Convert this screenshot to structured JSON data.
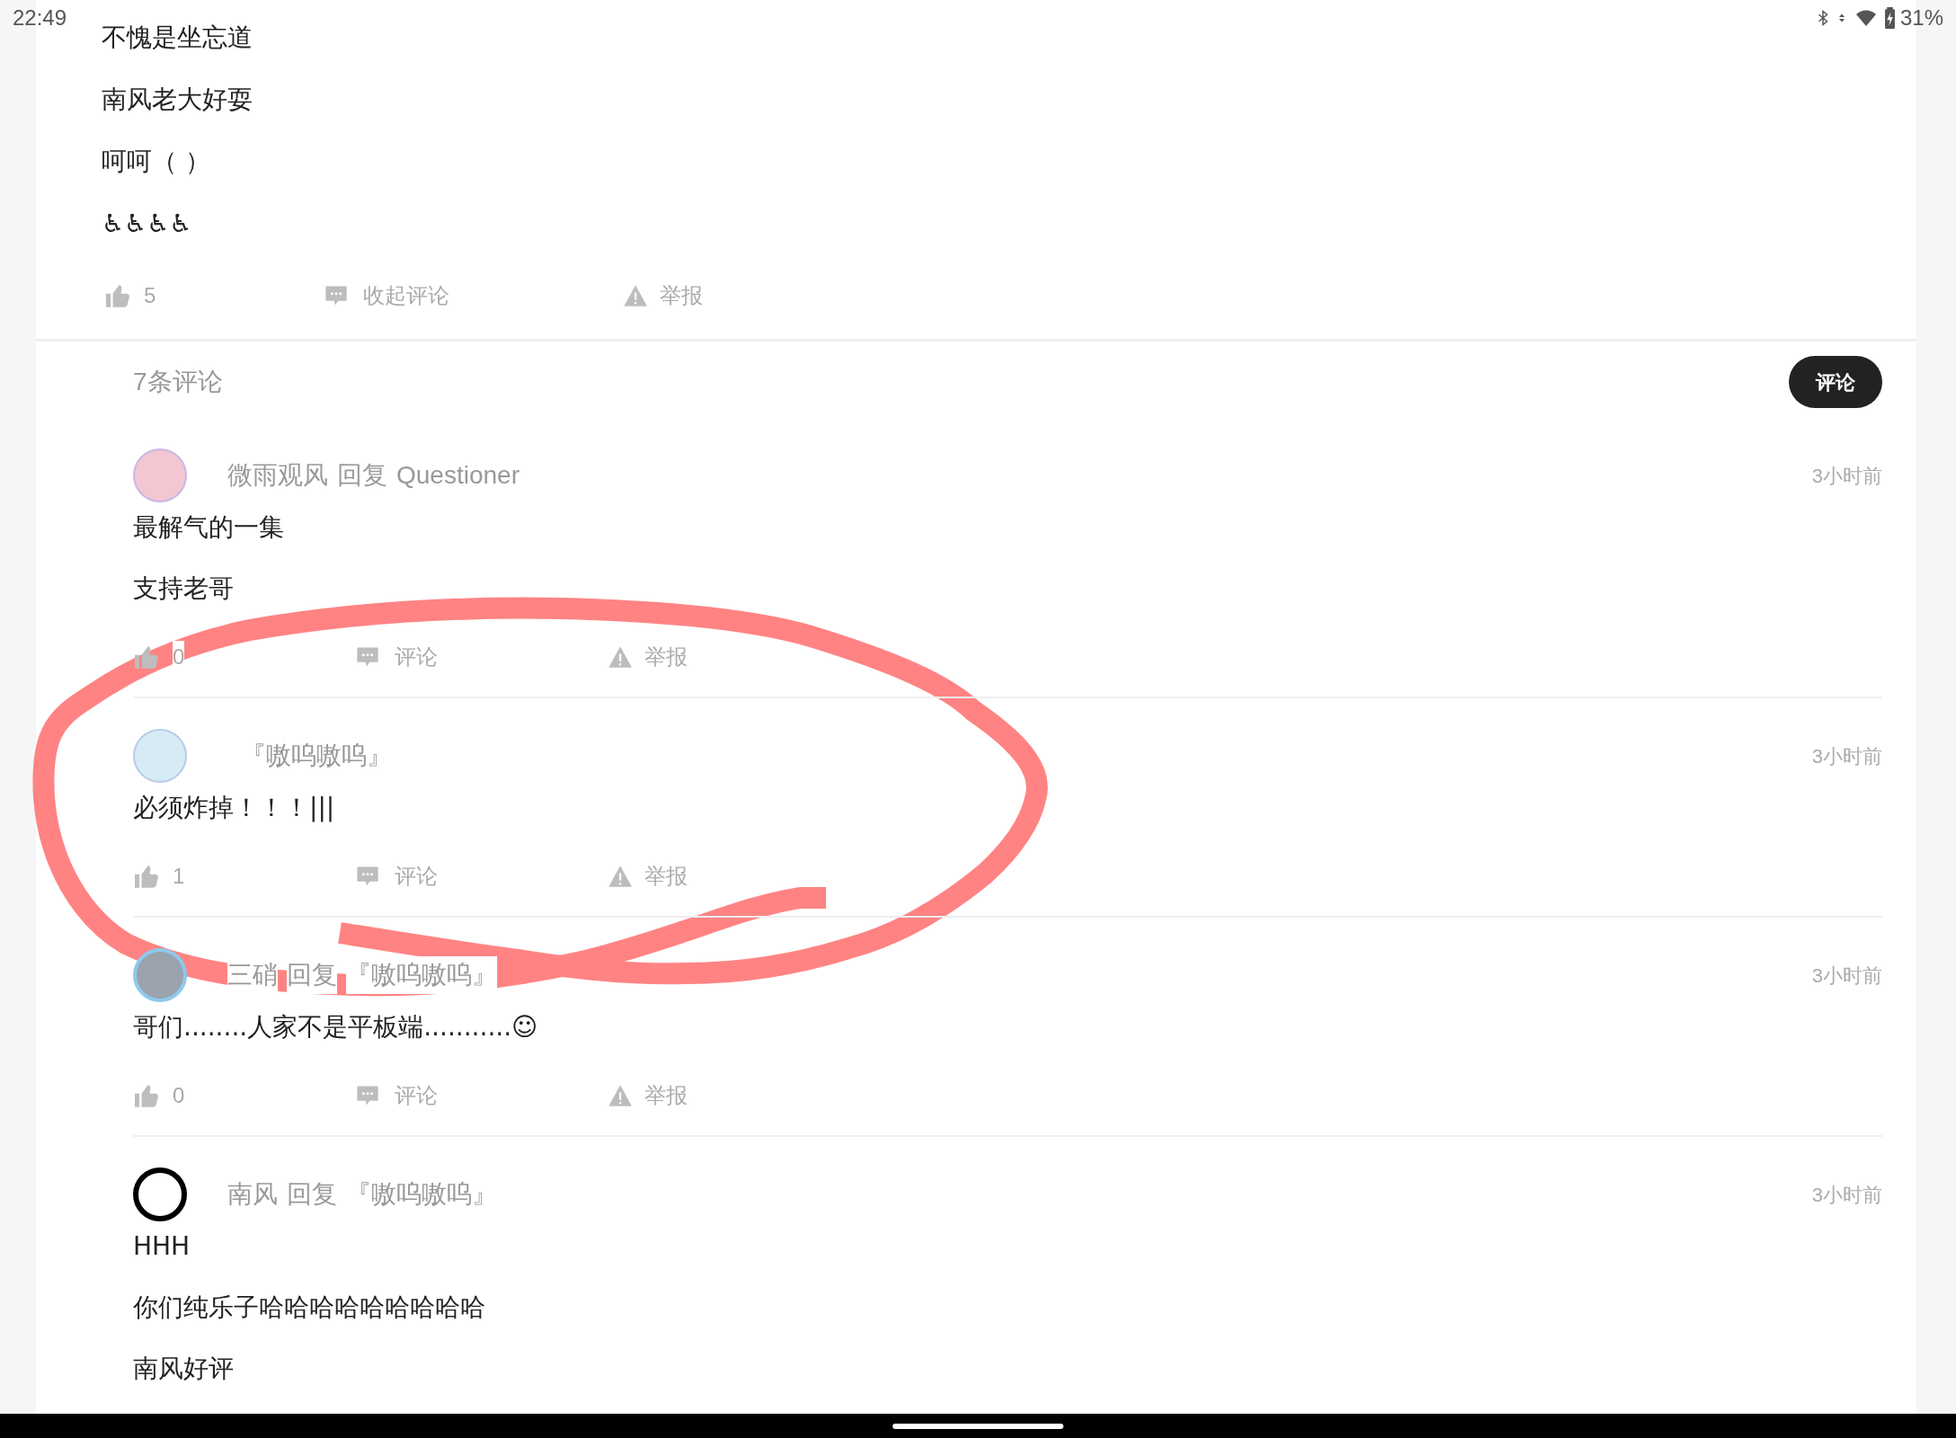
{
  "status_bar": {
    "time": "22:49",
    "battery": "31%"
  },
  "post": {
    "lines": [
      "不愧是坐忘道",
      "南风老大好耍",
      "呵呵（ ）",
      "♿♿♿♿"
    ],
    "actions": {
      "likes": "5",
      "comment": "收起评论",
      "report": "举报"
    }
  },
  "comments_header": {
    "count": "7条评论",
    "button": "评论"
  },
  "comments": [
    {
      "author": "微雨观风",
      "reply_label": "回复",
      "reply_to": "Questioner",
      "time": "3小时前",
      "lines": [
        "最解气的一集",
        "支持老哥"
      ],
      "likes": "0",
      "comment": "评论",
      "report": "举报"
    },
    {
      "author": "『嗷呜嗷呜』",
      "time": "3小时前",
      "lines": [
        "必须炸掉！！！|||"
      ],
      "likes": "1",
      "comment": "评论",
      "report": "举报"
    },
    {
      "author": "三硝",
      "reply_label": "回复",
      "reply_to": "『嗷呜嗷呜』",
      "time": "3小时前",
      "lines": [
        "哥们........人家不是平板端...........☺"
      ],
      "likes": "0",
      "comment": "评论",
      "report": "举报"
    },
    {
      "author": "南风",
      "reply_label": "回复",
      "reply_to": "『嗷呜嗷呜』",
      "time": "3小时前",
      "lines": [
        "HHH",
        "你们纯乐子哈哈哈哈哈哈哈哈哈",
        "南风好评"
      ]
    }
  ]
}
